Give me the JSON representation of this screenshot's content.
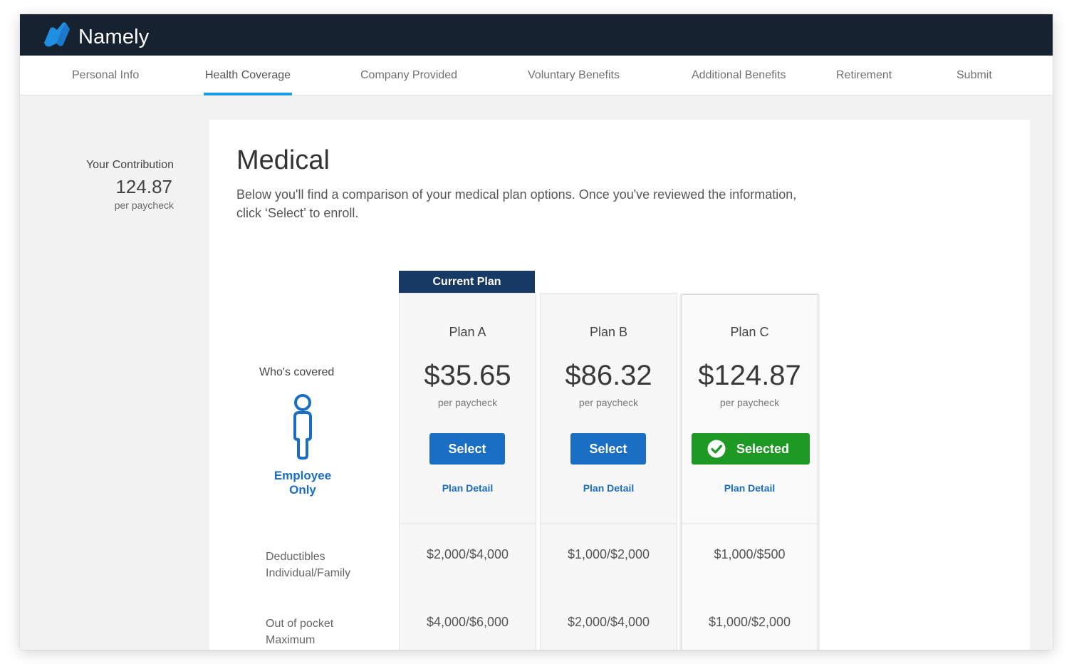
{
  "app": {
    "brand": "Namely",
    "logo_icon": "namely-logo-icon",
    "colors": {
      "header": "#162230",
      "tab_active": "#1e9be0",
      "primary": "#1a6ec3",
      "success": "#1e9a24",
      "banner": "#163a63"
    }
  },
  "tabs": [
    {
      "label": "Personal Info",
      "active": false
    },
    {
      "label": "Health Coverage",
      "active": true
    },
    {
      "label": "Company Provided",
      "active": false
    },
    {
      "label": "Voluntary Benefits",
      "active": false
    },
    {
      "label": "Additional Benefits",
      "active": false
    },
    {
      "label": "Retirement",
      "active": false
    },
    {
      "label": "Submit",
      "active": false
    }
  ],
  "contribution": {
    "label": "Your Contribution",
    "value": "124.87",
    "unit": "per paycheck"
  },
  "main": {
    "title": "Medical",
    "description": "Below you'll find a comparison of your medical plan options. Once you've reviewed the information, click ‘Select’ to enroll."
  },
  "coverage": {
    "label": "Who's covered",
    "icon": "person-icon",
    "line1": "Employee",
    "line2": "Only"
  },
  "rows": {
    "deductibles": {
      "line1": "Deductibles",
      "line2": "Individual/Family"
    },
    "out_of_pocket": {
      "line1": "Out of pocket",
      "line2": "Maximum"
    }
  },
  "current_plan_label": "Current Plan",
  "plans": [
    {
      "name": "Plan A",
      "price": "$35.65",
      "unit": "per paycheck",
      "action": "Select",
      "link": "Plan Detail",
      "deductibles": "$2,000/$4,000",
      "out_of_pocket": "$4,000/$6,000"
    },
    {
      "name": "Plan B",
      "price": "$86.32",
      "unit": "per paycheck",
      "action": "Select",
      "link": "Plan Detail",
      "deductibles": "$1,000/$2,000",
      "out_of_pocket": "$2,000/$4,000"
    },
    {
      "name": "Plan C",
      "price": "$124.87",
      "unit": "per paycheck",
      "action": "Selected",
      "link": "Plan Detail",
      "deductibles": "$1,000/$500",
      "out_of_pocket": "$1,000/$2,000"
    }
  ]
}
